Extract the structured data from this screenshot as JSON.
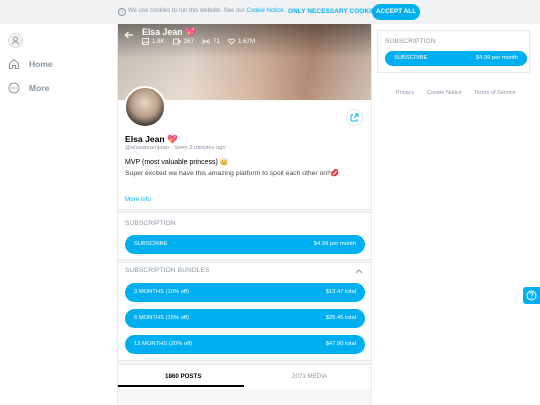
{
  "cookie": {
    "icon": "info-icon",
    "text_prefix": "We use cookies to run this website. See our ",
    "notice_link": "Cookie Notice",
    "text_suffix": " .",
    "necessary_label": "ONLY NECESSARY COOKIES",
    "accept_label": "ACCEPT ALL"
  },
  "nav": {
    "avatar_icon": "user-avatar-icon",
    "items": [
      {
        "label": "Home",
        "icon": "home-icon"
      },
      {
        "label": "More",
        "icon": "more-circle-icon"
      }
    ]
  },
  "cover": {
    "name": "Elsa Jean 💖",
    "stats": {
      "images": "1.8K",
      "videos": "267",
      "streams": "71",
      "likes": "1.67M"
    }
  },
  "profile": {
    "name": "Elsa Jean 💖",
    "handle": "@elsadreamjean",
    "seen": "Seen 2 minutes ago",
    "bio_line1": "MVP (most valuable princess) 👑",
    "bio_line2": "Super excited we have this amazing platform to spoil each other on!!💋",
    "more_info": "More info"
  },
  "subscription": {
    "title": "SUBSCRIPTION",
    "button_label": "SUBSCRIBE",
    "price": "$4.99 per month"
  },
  "bundles": {
    "title": "SUBSCRIPTION BUNDLES",
    "items": [
      {
        "label": "3 MONTHS (10% off)",
        "total": "$13.47 total"
      },
      {
        "label": "6 MONTHS (15% off)",
        "total": "$25.45 total"
      },
      {
        "label": "12 MONTHS (20% off)",
        "total": "$47.90 total"
      }
    ]
  },
  "tabs": {
    "posts": "1860 POSTS",
    "media": "2071 MEDIA"
  },
  "right": {
    "title": "SUBSCRIPTION",
    "button_label": "SUBSCRIBE",
    "price": "$4.99 per month",
    "footer": [
      "Privacy",
      "Cookie Notice",
      "Terms of Service"
    ]
  },
  "colors": {
    "accent": "#00aff0",
    "muted": "#8a96a3",
    "border": "#eaeaea"
  }
}
